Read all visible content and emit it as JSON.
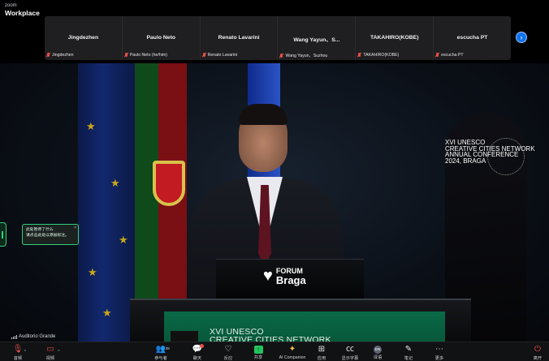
{
  "app": {
    "logo_small": "zoom",
    "logo_big": "Workplace"
  },
  "participants": [
    {
      "name": "Jingdezhen",
      "tag": "Jingdezhen"
    },
    {
      "name": "Paulo Neto",
      "tag": "Paulo Neto (he/him)"
    },
    {
      "name": "Renato Lavarini",
      "tag": "Renato Lavarini"
    },
    {
      "name": "Wang  Yayun、S...",
      "tag": "Wang  Yayun、Suzhou"
    },
    {
      "name": "TAKAHIRO(KOBE)",
      "tag": "TAKAHIRO(KOBE)"
    },
    {
      "name": "escucha PT",
      "tag": "escucha PT"
    }
  ],
  "stage": {
    "conference_label": [
      "XVI UNESCO",
      "CREATIVE CITIES NETWORK",
      "ANNUAL CONFERENCE",
      "2024, BRAGA"
    ],
    "lectern_logo": [
      "FORUM",
      "Braga"
    ],
    "banner_text": [
      "XVI UNESCO",
      "CREATIVE CITIES NETWORK"
    ],
    "audio_source": "Auditorio Grande"
  },
  "popup": {
    "line1": "此处暂停了什么",
    "line2": "请点击此处以添加标注。",
    "close": "×"
  },
  "toolbar": {
    "audio": "音频",
    "video": "视频",
    "participants": "参与者",
    "participants_count": "38",
    "chat": "聊天",
    "react": "反应",
    "share": "共享",
    "ai": "AI Companion",
    "apps": "应用",
    "captions": "显示字幕",
    "interpretation": "译语",
    "interpretation_code": "EN",
    "notes": "笔记",
    "more": "更多",
    "leave": "离开"
  },
  "colors": {
    "accent": "#0e72ed",
    "muted": "#e8504a",
    "share": "#22c55e",
    "banner": "#0a6a47",
    "popup_border": "#2fd07b"
  }
}
